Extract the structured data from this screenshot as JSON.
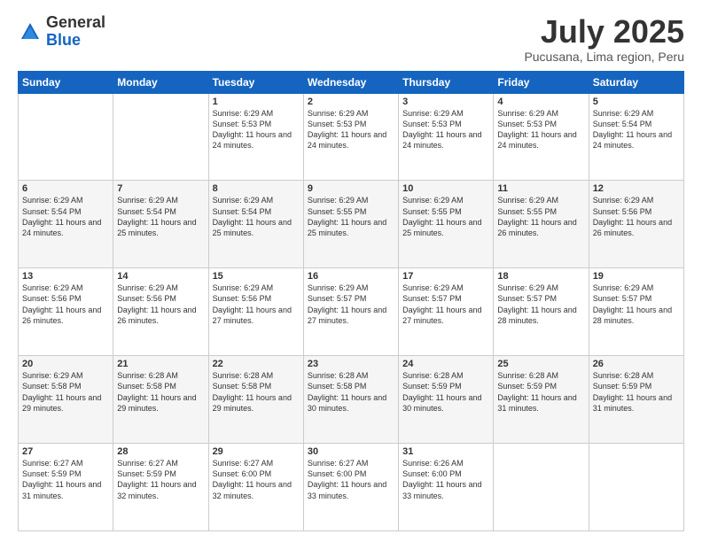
{
  "logo": {
    "general": "General",
    "blue": "Blue"
  },
  "header": {
    "month": "July 2025",
    "location": "Pucusana, Lima region, Peru"
  },
  "weekdays": [
    "Sunday",
    "Monday",
    "Tuesday",
    "Wednesday",
    "Thursday",
    "Friday",
    "Saturday"
  ],
  "weeks": [
    [
      {
        "day": "",
        "sunrise": "",
        "sunset": "",
        "daylight": ""
      },
      {
        "day": "",
        "sunrise": "",
        "sunset": "",
        "daylight": ""
      },
      {
        "day": "1",
        "sunrise": "Sunrise: 6:29 AM",
        "sunset": "Sunset: 5:53 PM",
        "daylight": "Daylight: 11 hours and 24 minutes."
      },
      {
        "day": "2",
        "sunrise": "Sunrise: 6:29 AM",
        "sunset": "Sunset: 5:53 PM",
        "daylight": "Daylight: 11 hours and 24 minutes."
      },
      {
        "day": "3",
        "sunrise": "Sunrise: 6:29 AM",
        "sunset": "Sunset: 5:53 PM",
        "daylight": "Daylight: 11 hours and 24 minutes."
      },
      {
        "day": "4",
        "sunrise": "Sunrise: 6:29 AM",
        "sunset": "Sunset: 5:53 PM",
        "daylight": "Daylight: 11 hours and 24 minutes."
      },
      {
        "day": "5",
        "sunrise": "Sunrise: 6:29 AM",
        "sunset": "Sunset: 5:54 PM",
        "daylight": "Daylight: 11 hours and 24 minutes."
      }
    ],
    [
      {
        "day": "6",
        "sunrise": "Sunrise: 6:29 AM",
        "sunset": "Sunset: 5:54 PM",
        "daylight": "Daylight: 11 hours and 24 minutes."
      },
      {
        "day": "7",
        "sunrise": "Sunrise: 6:29 AM",
        "sunset": "Sunset: 5:54 PM",
        "daylight": "Daylight: 11 hours and 25 minutes."
      },
      {
        "day": "8",
        "sunrise": "Sunrise: 6:29 AM",
        "sunset": "Sunset: 5:54 PM",
        "daylight": "Daylight: 11 hours and 25 minutes."
      },
      {
        "day": "9",
        "sunrise": "Sunrise: 6:29 AM",
        "sunset": "Sunset: 5:55 PM",
        "daylight": "Daylight: 11 hours and 25 minutes."
      },
      {
        "day": "10",
        "sunrise": "Sunrise: 6:29 AM",
        "sunset": "Sunset: 5:55 PM",
        "daylight": "Daylight: 11 hours and 25 minutes."
      },
      {
        "day": "11",
        "sunrise": "Sunrise: 6:29 AM",
        "sunset": "Sunset: 5:55 PM",
        "daylight": "Daylight: 11 hours and 26 minutes."
      },
      {
        "day": "12",
        "sunrise": "Sunrise: 6:29 AM",
        "sunset": "Sunset: 5:56 PM",
        "daylight": "Daylight: 11 hours and 26 minutes."
      }
    ],
    [
      {
        "day": "13",
        "sunrise": "Sunrise: 6:29 AM",
        "sunset": "Sunset: 5:56 PM",
        "daylight": "Daylight: 11 hours and 26 minutes."
      },
      {
        "day": "14",
        "sunrise": "Sunrise: 6:29 AM",
        "sunset": "Sunset: 5:56 PM",
        "daylight": "Daylight: 11 hours and 26 minutes."
      },
      {
        "day": "15",
        "sunrise": "Sunrise: 6:29 AM",
        "sunset": "Sunset: 5:56 PM",
        "daylight": "Daylight: 11 hours and 27 minutes."
      },
      {
        "day": "16",
        "sunrise": "Sunrise: 6:29 AM",
        "sunset": "Sunset: 5:57 PM",
        "daylight": "Daylight: 11 hours and 27 minutes."
      },
      {
        "day": "17",
        "sunrise": "Sunrise: 6:29 AM",
        "sunset": "Sunset: 5:57 PM",
        "daylight": "Daylight: 11 hours and 27 minutes."
      },
      {
        "day": "18",
        "sunrise": "Sunrise: 6:29 AM",
        "sunset": "Sunset: 5:57 PM",
        "daylight": "Daylight: 11 hours and 28 minutes."
      },
      {
        "day": "19",
        "sunrise": "Sunrise: 6:29 AM",
        "sunset": "Sunset: 5:57 PM",
        "daylight": "Daylight: 11 hours and 28 minutes."
      }
    ],
    [
      {
        "day": "20",
        "sunrise": "Sunrise: 6:29 AM",
        "sunset": "Sunset: 5:58 PM",
        "daylight": "Daylight: 11 hours and 29 minutes."
      },
      {
        "day": "21",
        "sunrise": "Sunrise: 6:28 AM",
        "sunset": "Sunset: 5:58 PM",
        "daylight": "Daylight: 11 hours and 29 minutes."
      },
      {
        "day": "22",
        "sunrise": "Sunrise: 6:28 AM",
        "sunset": "Sunset: 5:58 PM",
        "daylight": "Daylight: 11 hours and 29 minutes."
      },
      {
        "day": "23",
        "sunrise": "Sunrise: 6:28 AM",
        "sunset": "Sunset: 5:58 PM",
        "daylight": "Daylight: 11 hours and 30 minutes."
      },
      {
        "day": "24",
        "sunrise": "Sunrise: 6:28 AM",
        "sunset": "Sunset: 5:59 PM",
        "daylight": "Daylight: 11 hours and 30 minutes."
      },
      {
        "day": "25",
        "sunrise": "Sunrise: 6:28 AM",
        "sunset": "Sunset: 5:59 PM",
        "daylight": "Daylight: 11 hours and 31 minutes."
      },
      {
        "day": "26",
        "sunrise": "Sunrise: 6:28 AM",
        "sunset": "Sunset: 5:59 PM",
        "daylight": "Daylight: 11 hours and 31 minutes."
      }
    ],
    [
      {
        "day": "27",
        "sunrise": "Sunrise: 6:27 AM",
        "sunset": "Sunset: 5:59 PM",
        "daylight": "Daylight: 11 hours and 31 minutes."
      },
      {
        "day": "28",
        "sunrise": "Sunrise: 6:27 AM",
        "sunset": "Sunset: 5:59 PM",
        "daylight": "Daylight: 11 hours and 32 minutes."
      },
      {
        "day": "29",
        "sunrise": "Sunrise: 6:27 AM",
        "sunset": "Sunset: 6:00 PM",
        "daylight": "Daylight: 11 hours and 32 minutes."
      },
      {
        "day": "30",
        "sunrise": "Sunrise: 6:27 AM",
        "sunset": "Sunset: 6:00 PM",
        "daylight": "Daylight: 11 hours and 33 minutes."
      },
      {
        "day": "31",
        "sunrise": "Sunrise: 6:26 AM",
        "sunset": "Sunset: 6:00 PM",
        "daylight": "Daylight: 11 hours and 33 minutes."
      },
      {
        "day": "",
        "sunrise": "",
        "sunset": "",
        "daylight": ""
      },
      {
        "day": "",
        "sunrise": "",
        "sunset": "",
        "daylight": ""
      }
    ]
  ]
}
